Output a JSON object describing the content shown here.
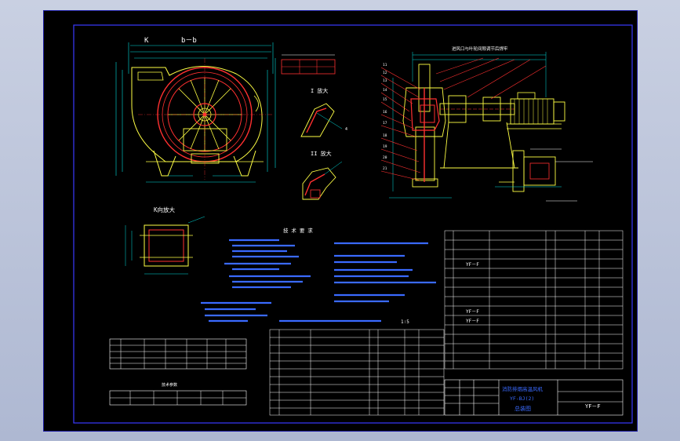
{
  "labels": {
    "view_left": "b－b",
    "view_left_prefix": "K",
    "view_enlarged": "K向放大",
    "detail_i": "I 放大",
    "detail_ii": "II 放大",
    "top_note": "进风口与叶轮间隙调节后焊牢",
    "tech_req_title": "技 术 要 求",
    "code_a": "YF－F",
    "code_b": "YF－F",
    "code_c": "YF－F",
    "sheet_code": "YF－F",
    "tb_line1": "消防排烟高温风机",
    "tb_line2": "YF-BJ(2)",
    "tb_line3": "总装图",
    "detail_table_title": "技术参数",
    "scale_mark": "1∶5"
  },
  "colors": {
    "frame": "#2a2aff",
    "outline": "#ffff44",
    "part": "#ff3030",
    "dim": "#00e0e0",
    "text": "#ffffff",
    "bg": "#000000"
  },
  "icons": {
    "fan": "fan-wheel-icon",
    "motor": "motor-icon"
  }
}
